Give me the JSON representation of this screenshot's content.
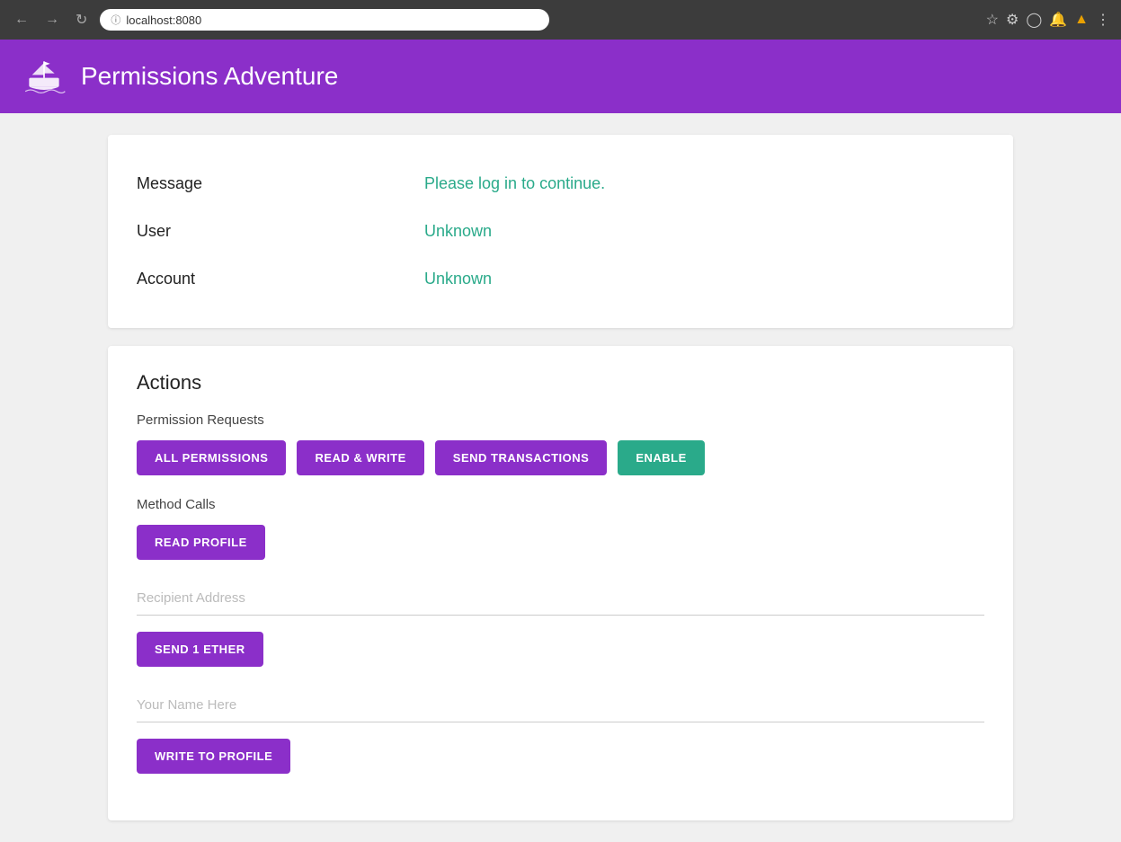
{
  "browser": {
    "url": "localhost:8080"
  },
  "header": {
    "title": "Permissions Adventure",
    "logo_alt": "Ship logo"
  },
  "info_card": {
    "message_label": "Message",
    "message_value": "Please log in to continue.",
    "user_label": "User",
    "user_value": "Unknown",
    "account_label": "Account",
    "account_value": "Unknown"
  },
  "actions_card": {
    "title": "Actions",
    "permission_requests_label": "Permission Requests",
    "buttons": {
      "all_permissions": "ALL PERMISSIONS",
      "read_write": "READ & WRITE",
      "send_transactions": "SEND TRANSACTIONS",
      "enable": "ENABLE"
    },
    "method_calls_label": "Method Calls",
    "read_profile_btn": "READ PROFILE",
    "recipient_placeholder": "Recipient Address",
    "send_ether_btn": "SEND 1 ETHER",
    "your_name_placeholder": "Your Name Here",
    "write_profile_btn": "WRITE TO PROFILE"
  },
  "colors": {
    "purple": "#8b2fc9",
    "teal": "#2aaa8a",
    "header_bg": "#8b2fc9"
  }
}
